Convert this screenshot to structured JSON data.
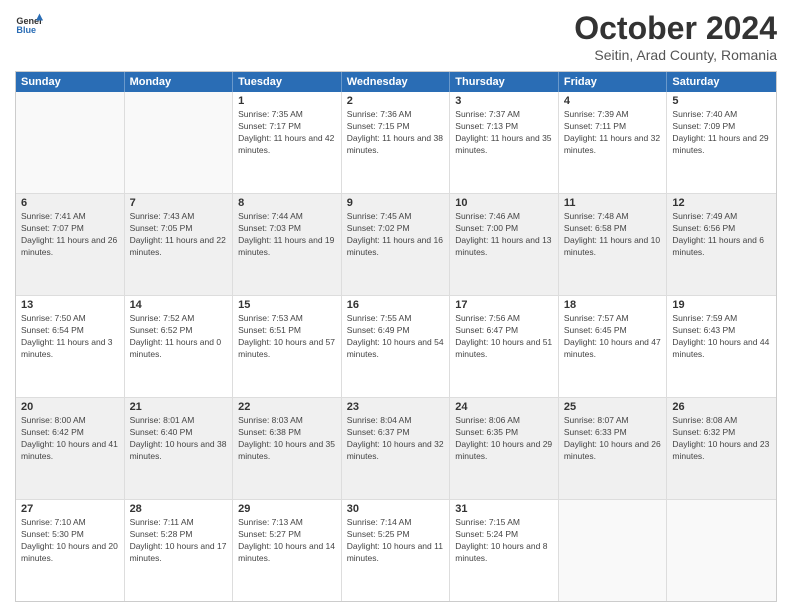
{
  "header": {
    "logo_general": "General",
    "logo_blue": "Blue",
    "title": "October 2024",
    "location": "Seitin, Arad County, Romania"
  },
  "weekdays": [
    "Sunday",
    "Monday",
    "Tuesday",
    "Wednesday",
    "Thursday",
    "Friday",
    "Saturday"
  ],
  "rows": [
    {
      "cells": [
        {
          "day": "",
          "content": "",
          "empty": true
        },
        {
          "day": "",
          "content": "",
          "empty": true
        },
        {
          "day": "1",
          "content": "Sunrise: 7:35 AM\nSunset: 7:17 PM\nDaylight: 11 hours and 42 minutes."
        },
        {
          "day": "2",
          "content": "Sunrise: 7:36 AM\nSunset: 7:15 PM\nDaylight: 11 hours and 38 minutes."
        },
        {
          "day": "3",
          "content": "Sunrise: 7:37 AM\nSunset: 7:13 PM\nDaylight: 11 hours and 35 minutes."
        },
        {
          "day": "4",
          "content": "Sunrise: 7:39 AM\nSunset: 7:11 PM\nDaylight: 11 hours and 32 minutes."
        },
        {
          "day": "5",
          "content": "Sunrise: 7:40 AM\nSunset: 7:09 PM\nDaylight: 11 hours and 29 minutes."
        }
      ]
    },
    {
      "cells": [
        {
          "day": "6",
          "content": "Sunrise: 7:41 AM\nSunset: 7:07 PM\nDaylight: 11 hours and 26 minutes."
        },
        {
          "day": "7",
          "content": "Sunrise: 7:43 AM\nSunset: 7:05 PM\nDaylight: 11 hours and 22 minutes."
        },
        {
          "day": "8",
          "content": "Sunrise: 7:44 AM\nSunset: 7:03 PM\nDaylight: 11 hours and 19 minutes."
        },
        {
          "day": "9",
          "content": "Sunrise: 7:45 AM\nSunset: 7:02 PM\nDaylight: 11 hours and 16 minutes."
        },
        {
          "day": "10",
          "content": "Sunrise: 7:46 AM\nSunset: 7:00 PM\nDaylight: 11 hours and 13 minutes."
        },
        {
          "day": "11",
          "content": "Sunrise: 7:48 AM\nSunset: 6:58 PM\nDaylight: 11 hours and 10 minutes."
        },
        {
          "day": "12",
          "content": "Sunrise: 7:49 AM\nSunset: 6:56 PM\nDaylight: 11 hours and 6 minutes."
        }
      ]
    },
    {
      "cells": [
        {
          "day": "13",
          "content": "Sunrise: 7:50 AM\nSunset: 6:54 PM\nDaylight: 11 hours and 3 minutes."
        },
        {
          "day": "14",
          "content": "Sunrise: 7:52 AM\nSunset: 6:52 PM\nDaylight: 11 hours and 0 minutes."
        },
        {
          "day": "15",
          "content": "Sunrise: 7:53 AM\nSunset: 6:51 PM\nDaylight: 10 hours and 57 minutes."
        },
        {
          "day": "16",
          "content": "Sunrise: 7:55 AM\nSunset: 6:49 PM\nDaylight: 10 hours and 54 minutes."
        },
        {
          "day": "17",
          "content": "Sunrise: 7:56 AM\nSunset: 6:47 PM\nDaylight: 10 hours and 51 minutes."
        },
        {
          "day": "18",
          "content": "Sunrise: 7:57 AM\nSunset: 6:45 PM\nDaylight: 10 hours and 47 minutes."
        },
        {
          "day": "19",
          "content": "Sunrise: 7:59 AM\nSunset: 6:43 PM\nDaylight: 10 hours and 44 minutes."
        }
      ]
    },
    {
      "cells": [
        {
          "day": "20",
          "content": "Sunrise: 8:00 AM\nSunset: 6:42 PM\nDaylight: 10 hours and 41 minutes."
        },
        {
          "day": "21",
          "content": "Sunrise: 8:01 AM\nSunset: 6:40 PM\nDaylight: 10 hours and 38 minutes."
        },
        {
          "day": "22",
          "content": "Sunrise: 8:03 AM\nSunset: 6:38 PM\nDaylight: 10 hours and 35 minutes."
        },
        {
          "day": "23",
          "content": "Sunrise: 8:04 AM\nSunset: 6:37 PM\nDaylight: 10 hours and 32 minutes."
        },
        {
          "day": "24",
          "content": "Sunrise: 8:06 AM\nSunset: 6:35 PM\nDaylight: 10 hours and 29 minutes."
        },
        {
          "day": "25",
          "content": "Sunrise: 8:07 AM\nSunset: 6:33 PM\nDaylight: 10 hours and 26 minutes."
        },
        {
          "day": "26",
          "content": "Sunrise: 8:08 AM\nSunset: 6:32 PM\nDaylight: 10 hours and 23 minutes."
        }
      ]
    },
    {
      "cells": [
        {
          "day": "27",
          "content": "Sunrise: 7:10 AM\nSunset: 5:30 PM\nDaylight: 10 hours and 20 minutes."
        },
        {
          "day": "28",
          "content": "Sunrise: 7:11 AM\nSunset: 5:28 PM\nDaylight: 10 hours and 17 minutes."
        },
        {
          "day": "29",
          "content": "Sunrise: 7:13 AM\nSunset: 5:27 PM\nDaylight: 10 hours and 14 minutes."
        },
        {
          "day": "30",
          "content": "Sunrise: 7:14 AM\nSunset: 5:25 PM\nDaylight: 10 hours and 11 minutes."
        },
        {
          "day": "31",
          "content": "Sunrise: 7:15 AM\nSunset: 5:24 PM\nDaylight: 10 hours and 8 minutes."
        },
        {
          "day": "",
          "content": "",
          "empty": true
        },
        {
          "day": "",
          "content": "",
          "empty": true
        }
      ]
    }
  ]
}
